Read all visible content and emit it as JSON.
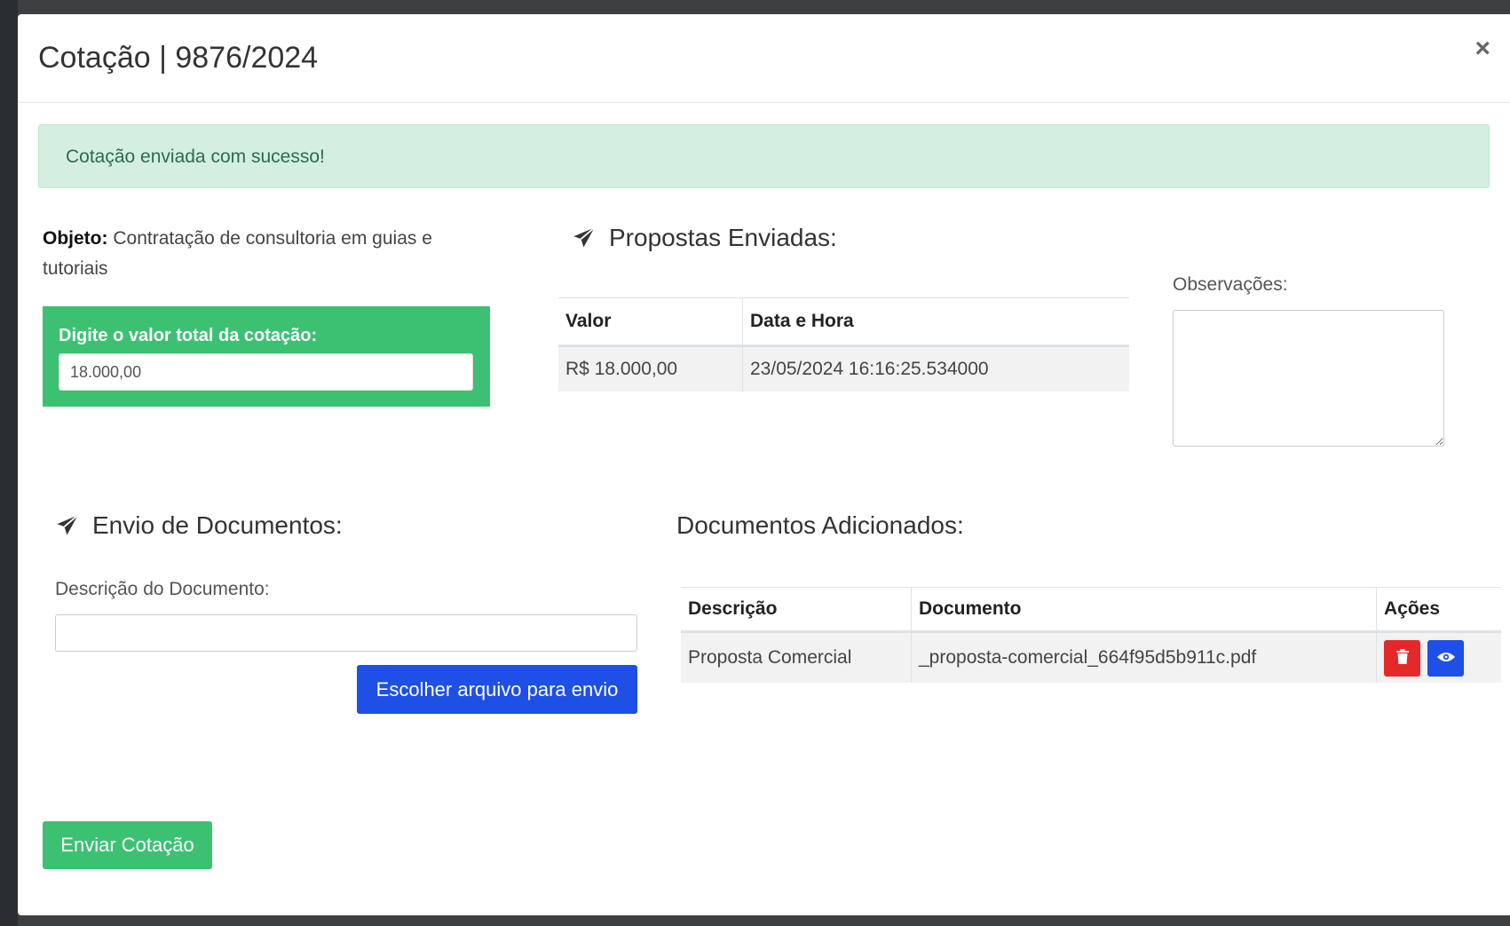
{
  "modal": {
    "title": "Cotação | 9876/2024",
    "close_label": "×"
  },
  "alert": {
    "message": "Cotação enviada com sucesso!"
  },
  "objeto": {
    "label": "Objeto:",
    "text": "Contratação de consultoria em guias e tutoriais"
  },
  "valor": {
    "label": "Digite o valor total da cotação:",
    "value": "18.000,00"
  },
  "propostas": {
    "heading": "Propostas Enviadas:",
    "columns": [
      "Valor",
      "Data e Hora"
    ],
    "rows": [
      [
        "R$ 18.000,00",
        "23/05/2024 16:16:25.534000"
      ]
    ]
  },
  "observacoes": {
    "label": "Observações:",
    "value": ""
  },
  "envio": {
    "heading": "Envio de Documentos:",
    "desc_label": "Descrição do Documento:",
    "desc_value": "",
    "file_button": "Escolher arquivo para envio"
  },
  "documentos": {
    "heading": "Documentos Adicionados:",
    "columns": [
      "Descrição",
      "Documento",
      "Ações"
    ],
    "rows": [
      {
        "descricao": "Proposta Comercial",
        "documento": "_proposta-comercial_664f95d5b911c.pdf"
      }
    ],
    "actions": [
      "trash-icon",
      "eye-icon"
    ]
  },
  "submit": {
    "label": "Enviar Cotação"
  },
  "colors": {
    "success": "#3cc173",
    "primary": "#1e4fe6",
    "danger": "#e32929",
    "alert_bg": "#d4efdf"
  }
}
